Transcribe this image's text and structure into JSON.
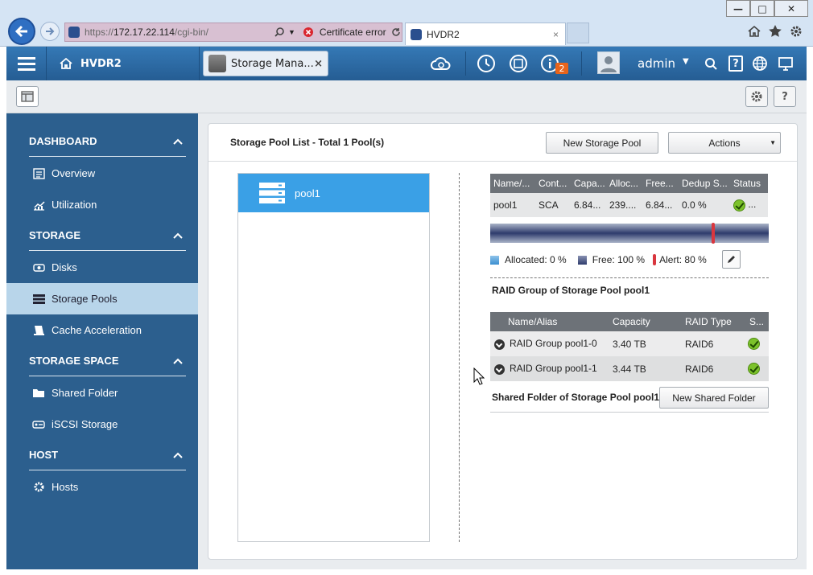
{
  "browser": {
    "url_prefix": "https://",
    "url_host": "172.17.22.114",
    "url_path": "/cgi-bin/",
    "cert_error": "Certificate error",
    "tab_title": "HVDR2",
    "tab_close": "×",
    "window_controls": [
      "minimize",
      "maximize",
      "close"
    ]
  },
  "app": {
    "home_label": "HVDR2",
    "open_tab_label": "Storage Mana...",
    "open_tab_close": "×",
    "user": "admin",
    "notification_count": "2",
    "help_label": "?"
  },
  "sidebar": {
    "sections": [
      {
        "title": "DASHBOARD",
        "items": [
          {
            "label": "Overview",
            "icon": "overview-icon"
          },
          {
            "label": "Utilization",
            "icon": "chart-icon"
          }
        ]
      },
      {
        "title": "STORAGE",
        "items": [
          {
            "label": "Disks",
            "icon": "disk-icon"
          },
          {
            "label": "Storage Pools",
            "icon": "pool-icon",
            "active": true
          },
          {
            "label": "Cache Acceleration",
            "icon": "cache-icon"
          }
        ]
      },
      {
        "title": "STORAGE SPACE",
        "items": [
          {
            "label": "Shared Folder",
            "icon": "folder-icon"
          },
          {
            "label": "iSCSI Storage",
            "icon": "iscsi-icon"
          }
        ]
      },
      {
        "title": "HOST",
        "items": [
          {
            "label": "Hosts",
            "icon": "gear-icon"
          }
        ]
      }
    ]
  },
  "main": {
    "list_title": "Storage Pool List - Total 1 Pool(s)",
    "new_pool_button": "New Storage Pool",
    "actions_button": "Actions",
    "pools": [
      "pool1"
    ],
    "pool_table": {
      "headers": [
        "Name/...",
        "Cont...",
        "Capa...",
        "Alloc...",
        "Free...",
        "Dedup S...",
        "Status"
      ],
      "row": {
        "name": "pool1",
        "controller": "SCA",
        "capacity": "6.84...",
        "allocated": "239....",
        "free": "6.84...",
        "dedup": "0.0 %",
        "status_more": "..."
      }
    },
    "usage": {
      "allocated_label": "Allocated: 0 %",
      "free_label": "Free: 100 %",
      "alert_label": "Alert: 80 %",
      "alert_threshold": 0.8,
      "allocated_color": "#3a8fd0",
      "free_color": "#2e3b6c",
      "alert_color": "#d9363e"
    },
    "raid_title": "RAID Group of Storage Pool pool1",
    "raid_table": {
      "headers": [
        "Name/Alias",
        "Capacity",
        "RAID Type",
        "S..."
      ],
      "rows": [
        {
          "name": "RAID Group pool1-0",
          "capacity": "3.40 TB",
          "type": "RAID6"
        },
        {
          "name": "RAID Group pool1-1",
          "capacity": "3.44 TB",
          "type": "RAID6"
        }
      ]
    },
    "shared_title": "Shared Folder of Storage Pool pool1",
    "new_shared_button": "New Shared Folder"
  }
}
